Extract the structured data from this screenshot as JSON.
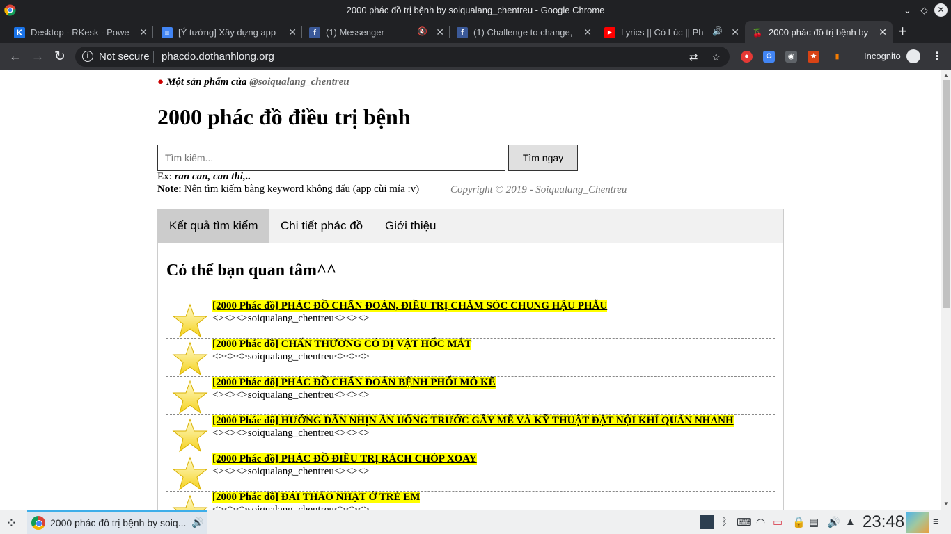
{
  "window": {
    "title": "2000 phác đồ trị bệnh by soiqualang_chentreu - Google Chrome",
    "buttons": {
      "minimize": "⌄",
      "restore": "◇",
      "close": "✕"
    }
  },
  "tabs": [
    {
      "label": "Desktop - RKesk - Powerd",
      "favicon": "K",
      "color": "#1a73e8"
    },
    {
      "label": "[Ý tưởng] Xây dựng app",
      "favicon": "≡",
      "color": "#4285f4"
    },
    {
      "label": "(1) Messenger",
      "favicon": "f",
      "color": "#3b5998",
      "audio": "🔇"
    },
    {
      "label": "(1) Challenge to change,",
      "favicon": "f",
      "color": "#3b5998"
    },
    {
      "label": "Lyrics || Có Lúc || Ph",
      "favicon": "▶",
      "color": "#ff0000",
      "audio": "🔊"
    },
    {
      "label": "2000 phác đồ trị bệnh by",
      "favicon": "🍒",
      "color": "transparent",
      "active": true
    }
  ],
  "toolbar": {
    "security_label": "Not secure",
    "url": "phacdo.dothanhlong.org",
    "incognito_label": "Incognito"
  },
  "page": {
    "brand_prefix": "Một sản phẩm của",
    "brand_handle": "@soiqualang_chentreu",
    "heading": "2000 phác đồ điều trị bệnh",
    "search_placeholder": "Tìm kiếm...",
    "search_button": "Tìm ngay",
    "example_prefix": "Ex:",
    "example_text": "ran can, can thi,..",
    "note_label": "Note:",
    "note_text": "Nên tìm kiếm bằng keyword không dấu (app cùi mía :v)",
    "copyright": "Copyright © 2019 - Soiqualang_Chentreu",
    "tabs": [
      {
        "label": "Kết quả tìm kiếm",
        "active": true
      },
      {
        "label": "Chi tiết phác đồ"
      },
      {
        "label": "Giới thiệu"
      }
    ],
    "section_title": "Có thể bạn quan tâm^^",
    "results": [
      {
        "title": "[2000 Phác đồ] PHÁC ĐỒ CHẨN ĐOÁN, ĐIỀU TRỊ CHĂM SÓC CHUNG HẬU PHẪU",
        "author": "<><><>soiqualang_chentreu<><><>"
      },
      {
        "title": "[2000 Phác đồ] CHẤN THƯƠNG CÓ DỊ VẬT HỐC MẮT",
        "author": "<><><>soiqualang_chentreu<><><>"
      },
      {
        "title": "[2000 Phác đồ] PHÁC ĐỒ CHẨN ĐOÁN BỆNH PHỔI MÔ KẼ",
        "author": "<><><>soiqualang_chentreu<><><>"
      },
      {
        "title": "[2000 Phác đồ] HƯỚNG DẪN NHỊN ĂN UỐNG TRƯỚC GÂY MÊ VÀ KỸ THUẬT ĐẶT NỘI KHÍ QUẢN NHANH",
        "author": "<><><>soiqualang_chentreu<><><>"
      },
      {
        "title": "[2000 Phác đồ] PHÁC ĐỒ ĐIỀU TRỊ RÁCH CHÓP XOAY",
        "author": "<><><>soiqualang_chentreu<><><>"
      },
      {
        "title": "[2000 Phác đồ] ĐÁI THÁO NHẠT Ở TRẺ EM",
        "author": "<><><>soiqualang_chentreu<><><>"
      }
    ]
  },
  "taskbar": {
    "task_label": "2000 phác đồ trị bệnh by soiq...",
    "clock": "23:48"
  }
}
